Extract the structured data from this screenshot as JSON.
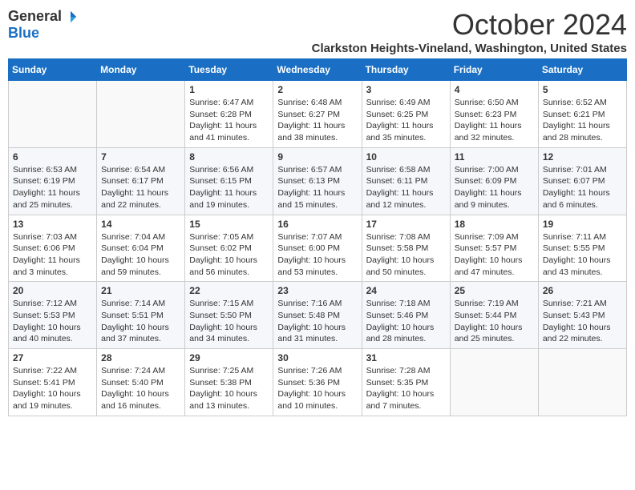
{
  "logo": {
    "general": "General",
    "blue": "Blue"
  },
  "title": "October 2024",
  "subtitle": "Clarkston Heights-Vineland, Washington, United States",
  "days_of_week": [
    "Sunday",
    "Monday",
    "Tuesday",
    "Wednesday",
    "Thursday",
    "Friday",
    "Saturday"
  ],
  "weeks": [
    [
      {
        "day": "",
        "info": ""
      },
      {
        "day": "",
        "info": ""
      },
      {
        "day": "1",
        "info": "Sunrise: 6:47 AM\nSunset: 6:28 PM\nDaylight: 11 hours and 41 minutes."
      },
      {
        "day": "2",
        "info": "Sunrise: 6:48 AM\nSunset: 6:27 PM\nDaylight: 11 hours and 38 minutes."
      },
      {
        "day": "3",
        "info": "Sunrise: 6:49 AM\nSunset: 6:25 PM\nDaylight: 11 hours and 35 minutes."
      },
      {
        "day": "4",
        "info": "Sunrise: 6:50 AM\nSunset: 6:23 PM\nDaylight: 11 hours and 32 minutes."
      },
      {
        "day": "5",
        "info": "Sunrise: 6:52 AM\nSunset: 6:21 PM\nDaylight: 11 hours and 28 minutes."
      }
    ],
    [
      {
        "day": "6",
        "info": "Sunrise: 6:53 AM\nSunset: 6:19 PM\nDaylight: 11 hours and 25 minutes."
      },
      {
        "day": "7",
        "info": "Sunrise: 6:54 AM\nSunset: 6:17 PM\nDaylight: 11 hours and 22 minutes."
      },
      {
        "day": "8",
        "info": "Sunrise: 6:56 AM\nSunset: 6:15 PM\nDaylight: 11 hours and 19 minutes."
      },
      {
        "day": "9",
        "info": "Sunrise: 6:57 AM\nSunset: 6:13 PM\nDaylight: 11 hours and 15 minutes."
      },
      {
        "day": "10",
        "info": "Sunrise: 6:58 AM\nSunset: 6:11 PM\nDaylight: 11 hours and 12 minutes."
      },
      {
        "day": "11",
        "info": "Sunrise: 7:00 AM\nSunset: 6:09 PM\nDaylight: 11 hours and 9 minutes."
      },
      {
        "day": "12",
        "info": "Sunrise: 7:01 AM\nSunset: 6:07 PM\nDaylight: 11 hours and 6 minutes."
      }
    ],
    [
      {
        "day": "13",
        "info": "Sunrise: 7:03 AM\nSunset: 6:06 PM\nDaylight: 11 hours and 3 minutes."
      },
      {
        "day": "14",
        "info": "Sunrise: 7:04 AM\nSunset: 6:04 PM\nDaylight: 10 hours and 59 minutes."
      },
      {
        "day": "15",
        "info": "Sunrise: 7:05 AM\nSunset: 6:02 PM\nDaylight: 10 hours and 56 minutes."
      },
      {
        "day": "16",
        "info": "Sunrise: 7:07 AM\nSunset: 6:00 PM\nDaylight: 10 hours and 53 minutes."
      },
      {
        "day": "17",
        "info": "Sunrise: 7:08 AM\nSunset: 5:58 PM\nDaylight: 10 hours and 50 minutes."
      },
      {
        "day": "18",
        "info": "Sunrise: 7:09 AM\nSunset: 5:57 PM\nDaylight: 10 hours and 47 minutes."
      },
      {
        "day": "19",
        "info": "Sunrise: 7:11 AM\nSunset: 5:55 PM\nDaylight: 10 hours and 43 minutes."
      }
    ],
    [
      {
        "day": "20",
        "info": "Sunrise: 7:12 AM\nSunset: 5:53 PM\nDaylight: 10 hours and 40 minutes."
      },
      {
        "day": "21",
        "info": "Sunrise: 7:14 AM\nSunset: 5:51 PM\nDaylight: 10 hours and 37 minutes."
      },
      {
        "day": "22",
        "info": "Sunrise: 7:15 AM\nSunset: 5:50 PM\nDaylight: 10 hours and 34 minutes."
      },
      {
        "day": "23",
        "info": "Sunrise: 7:16 AM\nSunset: 5:48 PM\nDaylight: 10 hours and 31 minutes."
      },
      {
        "day": "24",
        "info": "Sunrise: 7:18 AM\nSunset: 5:46 PM\nDaylight: 10 hours and 28 minutes."
      },
      {
        "day": "25",
        "info": "Sunrise: 7:19 AM\nSunset: 5:44 PM\nDaylight: 10 hours and 25 minutes."
      },
      {
        "day": "26",
        "info": "Sunrise: 7:21 AM\nSunset: 5:43 PM\nDaylight: 10 hours and 22 minutes."
      }
    ],
    [
      {
        "day": "27",
        "info": "Sunrise: 7:22 AM\nSunset: 5:41 PM\nDaylight: 10 hours and 19 minutes."
      },
      {
        "day": "28",
        "info": "Sunrise: 7:24 AM\nSunset: 5:40 PM\nDaylight: 10 hours and 16 minutes."
      },
      {
        "day": "29",
        "info": "Sunrise: 7:25 AM\nSunset: 5:38 PM\nDaylight: 10 hours and 13 minutes."
      },
      {
        "day": "30",
        "info": "Sunrise: 7:26 AM\nSunset: 5:36 PM\nDaylight: 10 hours and 10 minutes."
      },
      {
        "day": "31",
        "info": "Sunrise: 7:28 AM\nSunset: 5:35 PM\nDaylight: 10 hours and 7 minutes."
      },
      {
        "day": "",
        "info": ""
      },
      {
        "day": "",
        "info": ""
      }
    ]
  ]
}
